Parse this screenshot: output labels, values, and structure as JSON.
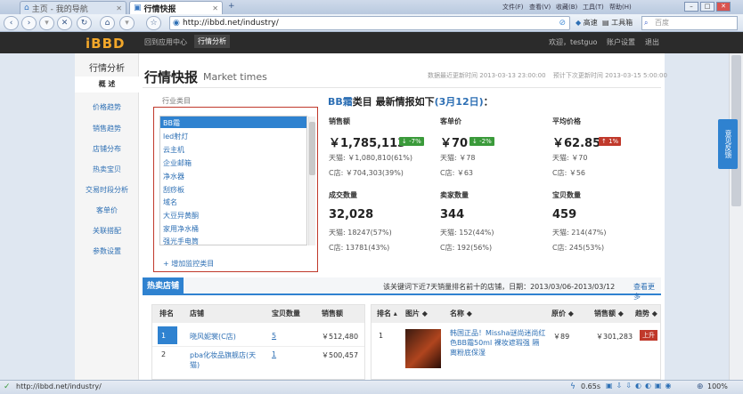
{
  "browser": {
    "tab1": "主页 - 我的导航",
    "tab2": "行情快报",
    "url": "http://ibbd.net/industry/",
    "speed_label": "高速",
    "tools_label": "工具箱",
    "search_placeholder": "百度",
    "menus": [
      "文件(F)",
      "查看(V)",
      "收藏(B)",
      "工具(T)",
      "帮助(H)"
    ]
  },
  "app": {
    "logo": "iBBD",
    "nav": [
      "回到应用中心",
      "行情分析"
    ],
    "welcome": "欢迎，testguo",
    "account": "账户设置",
    "logout": "退出"
  },
  "sidebar": {
    "title": "行情分析",
    "items": [
      "概 述",
      "价格趋势",
      "销售趋势",
      "店铺分布",
      "热卖宝贝",
      "交易时段分析",
      "客单价",
      "关联搭配",
      "参数设置"
    ]
  },
  "header": {
    "title": "行情快报",
    "title_en": "Market times",
    "last_update_label": "数据最近更新时间",
    "last_update": "2013-03-13 23:00:00",
    "next_update_label": "预计下次更新时间",
    "next_update": "2013-03-15 5:00:00"
  },
  "industry": {
    "label": "行业类目",
    "items": [
      "BB霜",
      "led射灯",
      "云主机",
      "企业邮箱",
      "净水器",
      "刮痧板",
      "域名",
      "大豆异黄酮",
      "家用净水桶",
      "强光手电筒"
    ],
    "selected": "BB霜",
    "add_label": "+ 增加监控类目"
  },
  "summary": {
    "category": "BB霜",
    "mid": "类目 最新情报如下",
    "date": "(3月12日)",
    "colon": "：",
    "metrics": [
      {
        "label": "销售额",
        "value": "￥1,785,113",
        "badge": "↓ -7%",
        "badge_color": "#3a9a3a",
        "tmall": "天猫: ￥1,080,810(61%)",
        "cshop": "C店: ￥704,303(39%)"
      },
      {
        "label": "客单价",
        "value": "￥70",
        "badge": "↓ -2%",
        "badge_color": "#3a9a3a",
        "tmall": "天猫: ￥78",
        "cshop": "C店: ￥63"
      },
      {
        "label": "平均价格",
        "value": "￥62.85",
        "badge": "↑ 1%",
        "badge_color": "#c0392b",
        "tmall": "天猫: ￥70",
        "cshop": "C店: ￥56"
      },
      {
        "label": "成交数量",
        "value": "32,028",
        "tmall": "天猫: 18247(57%)",
        "cshop": "C店: 13781(43%)"
      },
      {
        "label": "卖家数量",
        "value": "344",
        "tmall": "天猫: 152(44%)",
        "cshop": "C店: 192(56%)"
      },
      {
        "label": "宝贝数量",
        "value": "459",
        "tmall": "天猫: 214(47%)",
        "cshop": "C店: 245(53%)"
      }
    ]
  },
  "hot": {
    "title": "热卖店铺",
    "desc": "该关键词下近7天销量排名前十的店铺，日期：2013/03/06-2013/03/12",
    "more": "查看更多",
    "shop_headers": [
      "排名",
      "店铺",
      "宝贝数量",
      "销售额"
    ],
    "shops": [
      {
        "rank": "1",
        "name": "晓风妮裳(C店)",
        "count": "5",
        "sales": "￥512,480"
      },
      {
        "rank": "2",
        "name": "pba化妆品旗舰店(天猫)",
        "count": "1",
        "sales": "￥500,457"
      }
    ],
    "item_headers": [
      "排名 ▴",
      "图片 ◆",
      "名称 ◆",
      "原价 ◆",
      "销售额 ◆",
      "趋势 ◆"
    ],
    "items": [
      {
        "rank": "1",
        "name": "韩国正品！Missha谜尚迷尚红色BB霜50ml 裸妆遮瑕强 隔离粉底保湿",
        "price": "￥89",
        "sales": "￥301,283",
        "trend": "上升"
      }
    ]
  },
  "status": {
    "url": "http://ibbd.net/industry/",
    "time": "0.65s",
    "zoom": "100%"
  }
}
